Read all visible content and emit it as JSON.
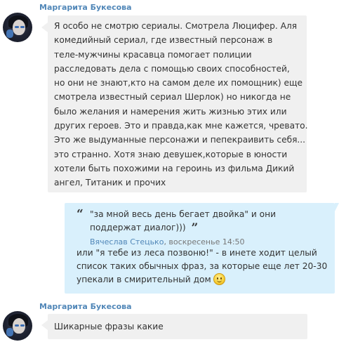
{
  "messages": [
    {
      "sender": "Маргарита Букесова",
      "lines": [
        "Я особо не смотрю сериалы. Смотрела Люцифер. Аля",
        "комедийный сериал, где известный персонаж в",
        "теле-мужчины красавца помогает полиции",
        "расследовать дела с помощью своих способностей,",
        "но они не знают,кто на самом деле их помощник) еще",
        "смотрела известный сериал Шерлок) но никогда не",
        "было желания и намерения жить жизнью этих или",
        "других героев. Это и правда,как мне кажется, чревато.",
        "Это же выдуманные персонажи и пепекраивить себя...",
        "это странно. Хотя знаю девушек,которые в юности",
        "хотели быть похожими на героинь из фильма Дикий",
        "ангел, Титаник и прочих"
      ]
    },
    {
      "quote": {
        "open_mark": "“",
        "close_mark": "”",
        "lines": [
          "\"за мной весь день бегает двойка\" и они",
          "поддержат диалог)))"
        ],
        "author": "Вячеслав Стецько",
        "time": ", воскресенье 14:50"
      },
      "reply_lines": [
        "или \"я тебе из леса позвоню!\" - в инете ходит целый",
        "список таких обычных фраз, за которые еще лет 20-30",
        "упекали в смирительный дом"
      ],
      "emoji": "smiley-emoji"
    },
    {
      "sender": "Маргарита Букесова",
      "text": "Шикарные фразы какие"
    }
  ]
}
